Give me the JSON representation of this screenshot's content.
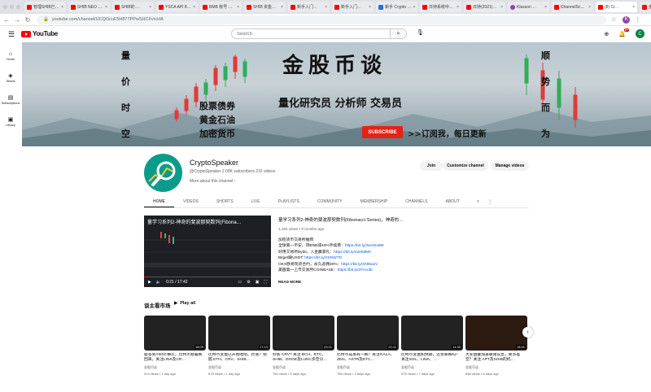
{
  "browser": {
    "tabs": [
      {
        "label": "管理SHIB已…",
        "active": false
      },
      {
        "label": "SHIB NEO …",
        "active": false
      },
      {
        "label": "SHIB的 …",
        "active": false
      },
      {
        "label": "YSCA API 8…",
        "active": false
      },
      {
        "label": "BMB 帐号 …",
        "active": false
      },
      {
        "label": "SHIB 资金…",
        "active": false
      },
      {
        "label": "新手入门…",
        "active": false
      },
      {
        "label": "新手入门…",
        "active": false
      },
      {
        "label": "新手 Crypto …",
        "active": false
      },
      {
        "label": "日持系统中…",
        "active": false
      },
      {
        "label": "日持(2021)…",
        "active": false
      },
      {
        "label": "Klasson …",
        "active": false
      },
      {
        "label": "ChannelSc…",
        "active": false
      },
      {
        "label": "(8) Cr…",
        "active": true
      },
      {
        "label": "金股币谈 · Y…",
        "active": false
      }
    ],
    "url": "youtube.com/channel/UCQOcuF5H877PPwSHCFvrcHA",
    "profile_initial": "K"
  },
  "youtube": {
    "logo_text": "YouTube",
    "search_placeholder": "Search",
    "notification_count": "9+",
    "avatar_initial": "C"
  },
  "sidebar": {
    "items": [
      {
        "label": "Home",
        "icon": "home-icon"
      },
      {
        "label": "Shorts",
        "icon": "shorts-icon"
      },
      {
        "label": "Subscriptions",
        "icon": "subscriptions-icon"
      },
      {
        "label": "Library",
        "icon": "library-icon"
      }
    ]
  },
  "banner": {
    "left_vertical": [
      "量",
      "价",
      "时",
      "空"
    ],
    "right_vertical": [
      "顺",
      "势",
      "而",
      "为"
    ],
    "title": "金股币谈",
    "subtitle": "量化研究员 分析师 交易员",
    "left_lines": [
      "股票债券",
      "黄金石油",
      "加密货币"
    ],
    "subscribe": "SUBSCRIBE",
    "cta": ">>订阅我，每日更新"
  },
  "channel": {
    "name": "CryptoSpeaker",
    "handle_stats": "@CryptoSpeaker  2.09K subscribers  216 videos",
    "more_about": "More about this channel",
    "join": "Join",
    "customize": "Customize channel",
    "manage": "Manage videos"
  },
  "tabs": [
    "HOME",
    "VIDEOS",
    "SHORTS",
    "LIVE",
    "PLAYLISTS",
    "COMMUNITY",
    "MEMBERSHIP",
    "CHANNELS",
    "ABOUT"
  ],
  "featured": {
    "player_title": "量学习系列2-神奇的斐波那契数列(Fibona…",
    "time": "0:21 / 17:42",
    "progress": 0.02,
    "title": "量学习系列2-神奇的斐波那契数列(Fibonacci Series)，神奇的…",
    "meta": "1,182 views • 8 months ago",
    "desc": [
      {
        "text": "加密货币交易所推荐:",
        "link": ""
      },
      {
        "text": "全球第一币安，持BNB减40%手续费：",
        "link": "https://bit.ly/3wUSu8M"
      },
      {
        "text": "好用交易所Bybit，入金赢豪礼：",
        "link": "https://bit.ly/42ebdM0"
      },
      {
        "text": "Bitget跟USDT: ",
        "link": "https://bit.ly/2SNWTD"
      },
      {
        "text": "OKX欧易现货合约，永久返佣30%：",
        "link": "https://bit.ly/3X65axV"
      },
      {
        "text": "美国第一上市交易所COINBASE：",
        "link": "https://bit.ly/3Yrcx3b"
      }
    ],
    "read_more": "READ MORE"
  },
  "shelf": {
    "title": "谈主看市场",
    "play_all": "Play all",
    "videos": [
      {
        "duration": "18:09",
        "title": "能等到AMSC横火。比特币顺着跌回来，关注LINK及CR…",
        "channel": "金股币谈",
        "meta": "414 views • 1 day ago"
      },
      {
        "duration": "17:13",
        "title": "比特币变盘已开始啦吧。抄底？把握 ETH、CRV、SHIB…",
        "channel": "金股币谈",
        "meta": "878 views • 1 day ago"
      },
      {
        "duration": "23:21",
        "title": "抄底 CRV? 关注 BCH、ETC、SHIB、DOGE及LUNC多空分…",
        "channel": "金股币谈",
        "meta": "760 views • 3 days ago"
      },
      {
        "duration": "22:11",
        "title": "比特币成离有一跌？关注GALA、ZEN、ASTR及ETC…",
        "channel": "金股币谈",
        "meta": "786 views • 3 days ago"
      },
      {
        "duration": "11:30",
        "title": "比特币变盘如预期，还会暴跌吗？关注SOL、LINK、…",
        "channel": "金股币谈",
        "meta": "575 views • 7 days ago"
      },
      {
        "duration": "18:41",
        "title": "大变盘叠加美联储议息，要多差空？关注 APT及SHIB的机…",
        "channel": "金股币谈",
        "meta": "658 views • 8 days ago"
      }
    ]
  }
}
